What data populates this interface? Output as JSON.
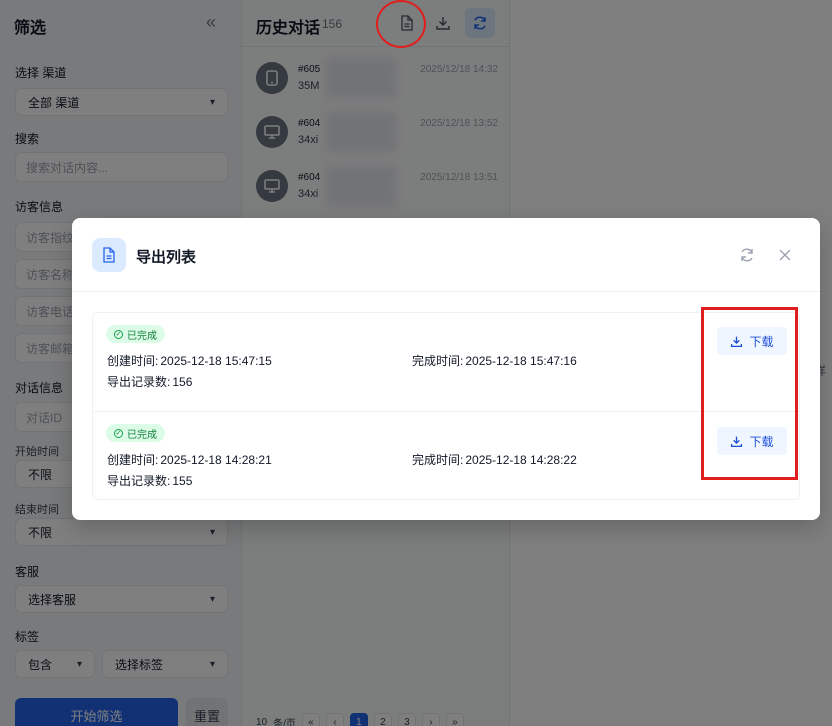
{
  "filter": {
    "title": "筛选",
    "channel_label": "选择 渠道",
    "channel_value": "全部 渠道",
    "search_label": "搜索",
    "search_placeholder": "搜索对话内容...",
    "visitor_label": "访客信息",
    "visitor_fields": [
      "访客指纹",
      "访客名称",
      "访客电话",
      "访客邮箱"
    ],
    "conversation_label": "对话信息",
    "conversation_id_placeholder": "对话ID",
    "start_label": "开始时间",
    "start_value": "不限",
    "end_label": "结束时间",
    "end_value": "不限",
    "agent_label": "客服",
    "agent_value": "选择客服",
    "tag_label": "标签",
    "tag_mode": "包含",
    "tag_value": "选择标签",
    "apply_button": "开始筛选",
    "reset_button": "重置"
  },
  "history": {
    "title": "历史对话",
    "count": "156",
    "items": [
      {
        "id": "#605",
        "msg": "35M",
        "time": "2025/12/18 14:32"
      },
      {
        "id": "#604",
        "msg": "34xi",
        "time": "2025/12/18 13:52"
      },
      {
        "id": "#604",
        "msg": "34xi",
        "time": "2025/12/18 13:51"
      }
    ],
    "pager": {
      "size": "10",
      "unit": "条/页",
      "pages": [
        "1",
        "2",
        "3"
      ]
    }
  },
  "modal": {
    "title": "导出列表",
    "records": [
      {
        "status": "已完成",
        "created_label": "创建时间:",
        "created_value": "2025-12-18 15:47:15",
        "completed_label": "完成时间:",
        "completed_value": "2025-12-18 15:47:16",
        "count_label": "导出记录数:",
        "count_value": "156",
        "download_label": "下载"
      },
      {
        "status": "已完成",
        "created_label": "创建时间:",
        "created_value": "2025-12-18 14:28:21",
        "completed_label": "完成时间:",
        "completed_value": "2025-12-18 14:28:22",
        "count_label": "导出记录数:",
        "count_value": "155",
        "download_label": "下载"
      }
    ]
  },
  "right_hint": "详",
  "colors": {
    "primary": "#2563eb",
    "success_bg": "#dcfce7",
    "success_text": "#15803d",
    "annotation": "#e11d1d"
  }
}
